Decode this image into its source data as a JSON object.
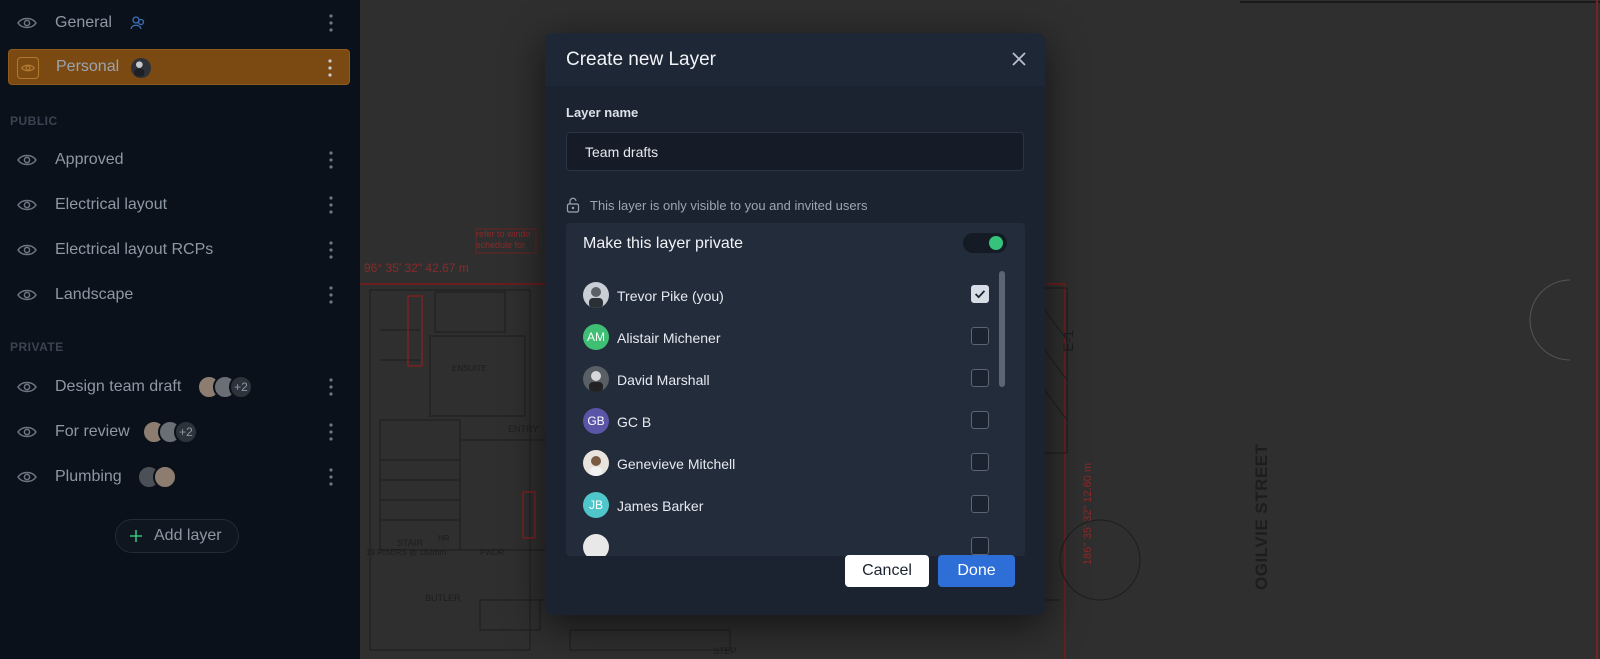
{
  "sidebar": {
    "layers_top": [
      {
        "label": "General",
        "icon": "team-icon"
      },
      {
        "label": "Personal",
        "active": true
      }
    ],
    "public_heading": "PUBLIC",
    "public_layers": [
      {
        "label": "Approved"
      },
      {
        "label": "Electrical layout"
      },
      {
        "label": "Electrical layout RCPs"
      },
      {
        "label": "Landscape"
      }
    ],
    "private_heading": "PRIVATE",
    "private_layers": [
      {
        "label": "Design team draft",
        "extra_count": "+2"
      },
      {
        "label": "For review",
        "extra_count": "+2"
      },
      {
        "label": "Plumbing"
      }
    ],
    "add_layer_label": "Add layer"
  },
  "drawing": {
    "street_name": "OGILVIE STREET",
    "dimension_top": "96° 35' 32\"  42.67 m",
    "dimension_side": "186° 35' 32\"  12.60 m",
    "note": "refer to windo schedule for",
    "labels": {
      "entry": "ENTRY",
      "stair": "STAIR",
      "risers": "19 RISERS @ 182mm",
      "butler": "BUTLER",
      "pwdr": "PWDR",
      "step": "STEP",
      "ensuite": "ENSUITE",
      "e1": "E-1",
      "hr": "HR"
    }
  },
  "modal": {
    "title": "Create new Layer",
    "name_label": "Layer name",
    "name_value": "Team drafts",
    "visibility_note": "This layer is only visible to you and invited users",
    "private_label": "Make this layer private",
    "private_enabled": true,
    "users": [
      {
        "name": "Trevor Pike (you)",
        "initials": "",
        "avatar_color": "#c9ced6",
        "checked": true
      },
      {
        "name": "Alistair Michener",
        "initials": "AM",
        "avatar_color": "#3fbf73",
        "checked": false
      },
      {
        "name": "David Marshall",
        "initials": "",
        "avatar_color": "#5a5f66",
        "checked": false
      },
      {
        "name": "GC B",
        "initials": "GB",
        "avatar_color": "#5a55a6",
        "checked": false
      },
      {
        "name": "Genevieve Mitchell",
        "initials": "",
        "avatar_color": "#e8e3dc",
        "checked": false
      },
      {
        "name": "James Barker",
        "initials": "JB",
        "avatar_color": "#4fc6c9",
        "checked": false
      },
      {
        "name": "",
        "initials": "",
        "avatar_color": "#e8e8e8",
        "checked": false
      }
    ],
    "cancel_label": "Cancel",
    "done_label": "Done"
  },
  "colors": {
    "accent": "#2d6fd6",
    "active_layer": "#7a4a12",
    "toggle_on": "#35c27a"
  }
}
